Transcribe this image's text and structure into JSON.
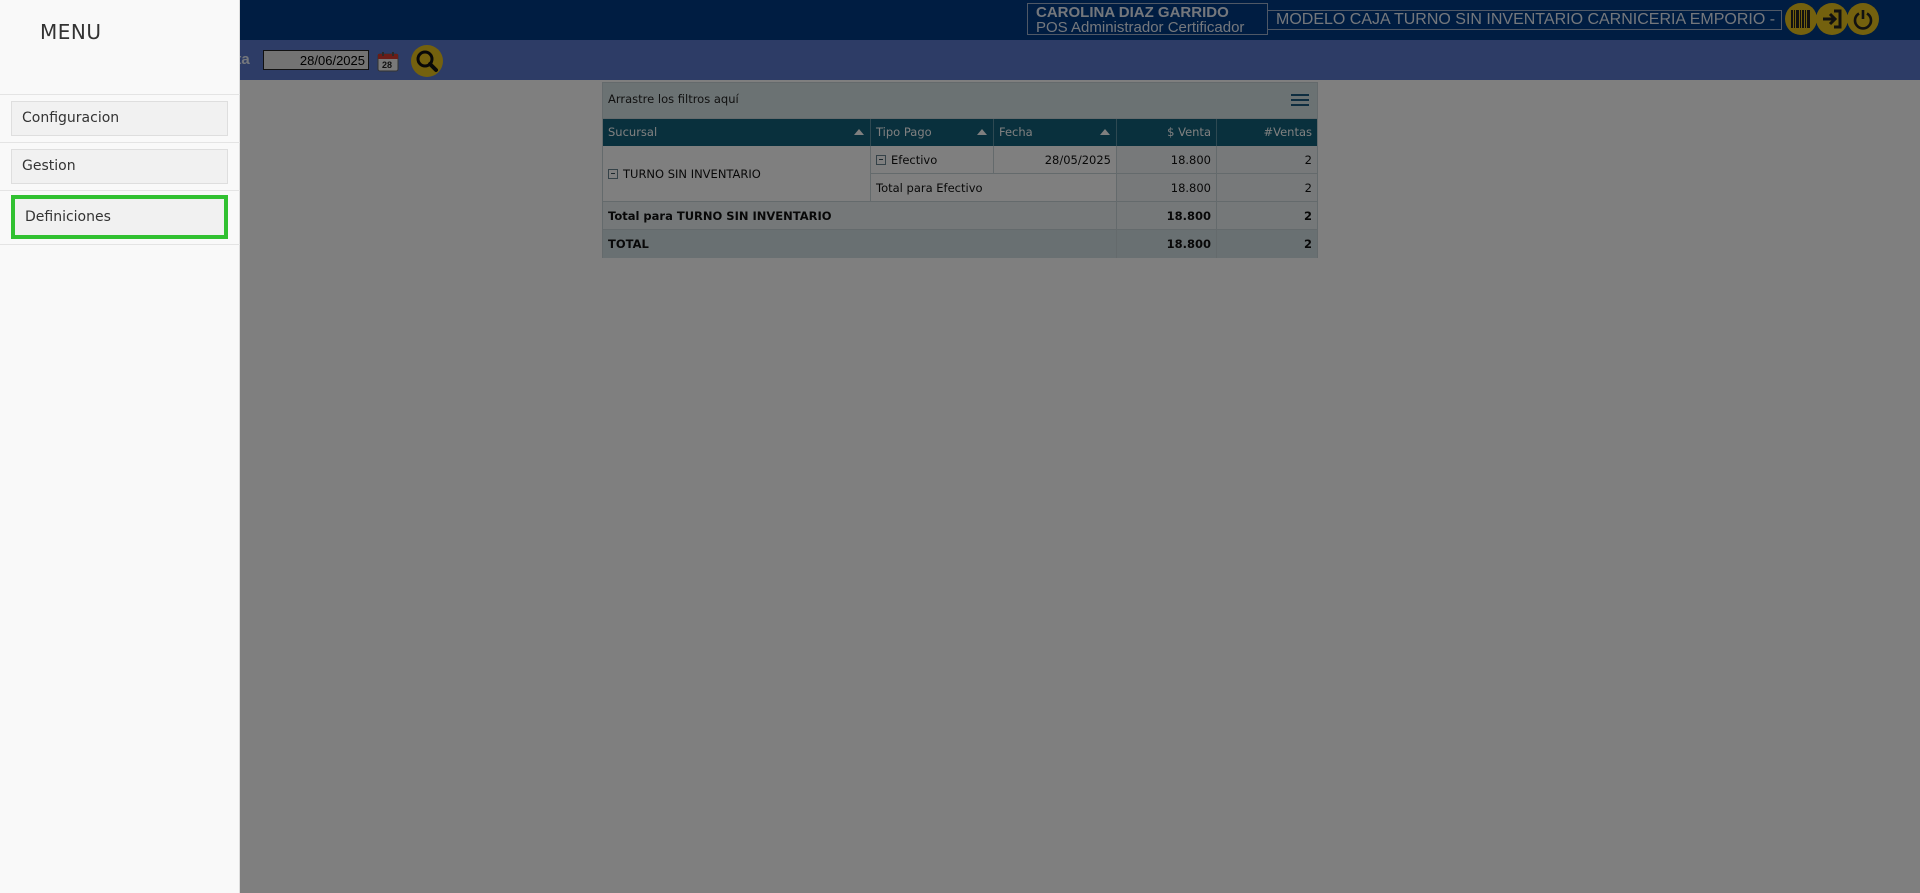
{
  "header": {
    "user_name": "CAROLINA DIAZ GARRIDO",
    "user_role": "POS Administrador Certificador",
    "model_name": "MODELO CAJA TURNO SIN INVENTARIO CARNICERIA EMPORIO -",
    "icons": [
      "barcode-icon",
      "login-icon",
      "power-icon"
    ]
  },
  "toolbar": {
    "hasta_label": "sta",
    "date_value": "28/06/2025",
    "calendar_day": "28"
  },
  "pivot": {
    "filter_drop_text": "Arrastre los filtros aquí",
    "columns": [
      "Sucursal",
      "Tipo Pago",
      "Fecha",
      "$ Venta",
      "#Ventas"
    ],
    "rows": {
      "sucursal": "TURNO SIN INVENTARIO",
      "tipo_pago": "Efectivo",
      "fecha": "28/05/2025",
      "venta": "18.800",
      "ventas": "2",
      "total_efectivo_label": "Total para Efectivo",
      "total_efectivo_venta": "18.800",
      "total_efectivo_ventas": "2",
      "total_sucursal_label": "Total para TURNO SIN INVENTARIO",
      "total_sucursal_venta": "18.800",
      "total_sucursal_ventas": "2",
      "grand_total_label": "TOTAL",
      "grand_total_venta": "18.800",
      "grand_total_ventas": "2"
    }
  },
  "menu": {
    "title": "MENU",
    "items": [
      {
        "label": "Configuracion"
      },
      {
        "label": "Gestion"
      },
      {
        "label": "Definiciones",
        "active": true
      }
    ]
  },
  "colors": {
    "header_bg": "#003b84",
    "toolbar_bg": "#5b78cc",
    "icon_yellow": "#e8c21c",
    "table_header": "#12607a",
    "active_outline": "#31c131"
  }
}
